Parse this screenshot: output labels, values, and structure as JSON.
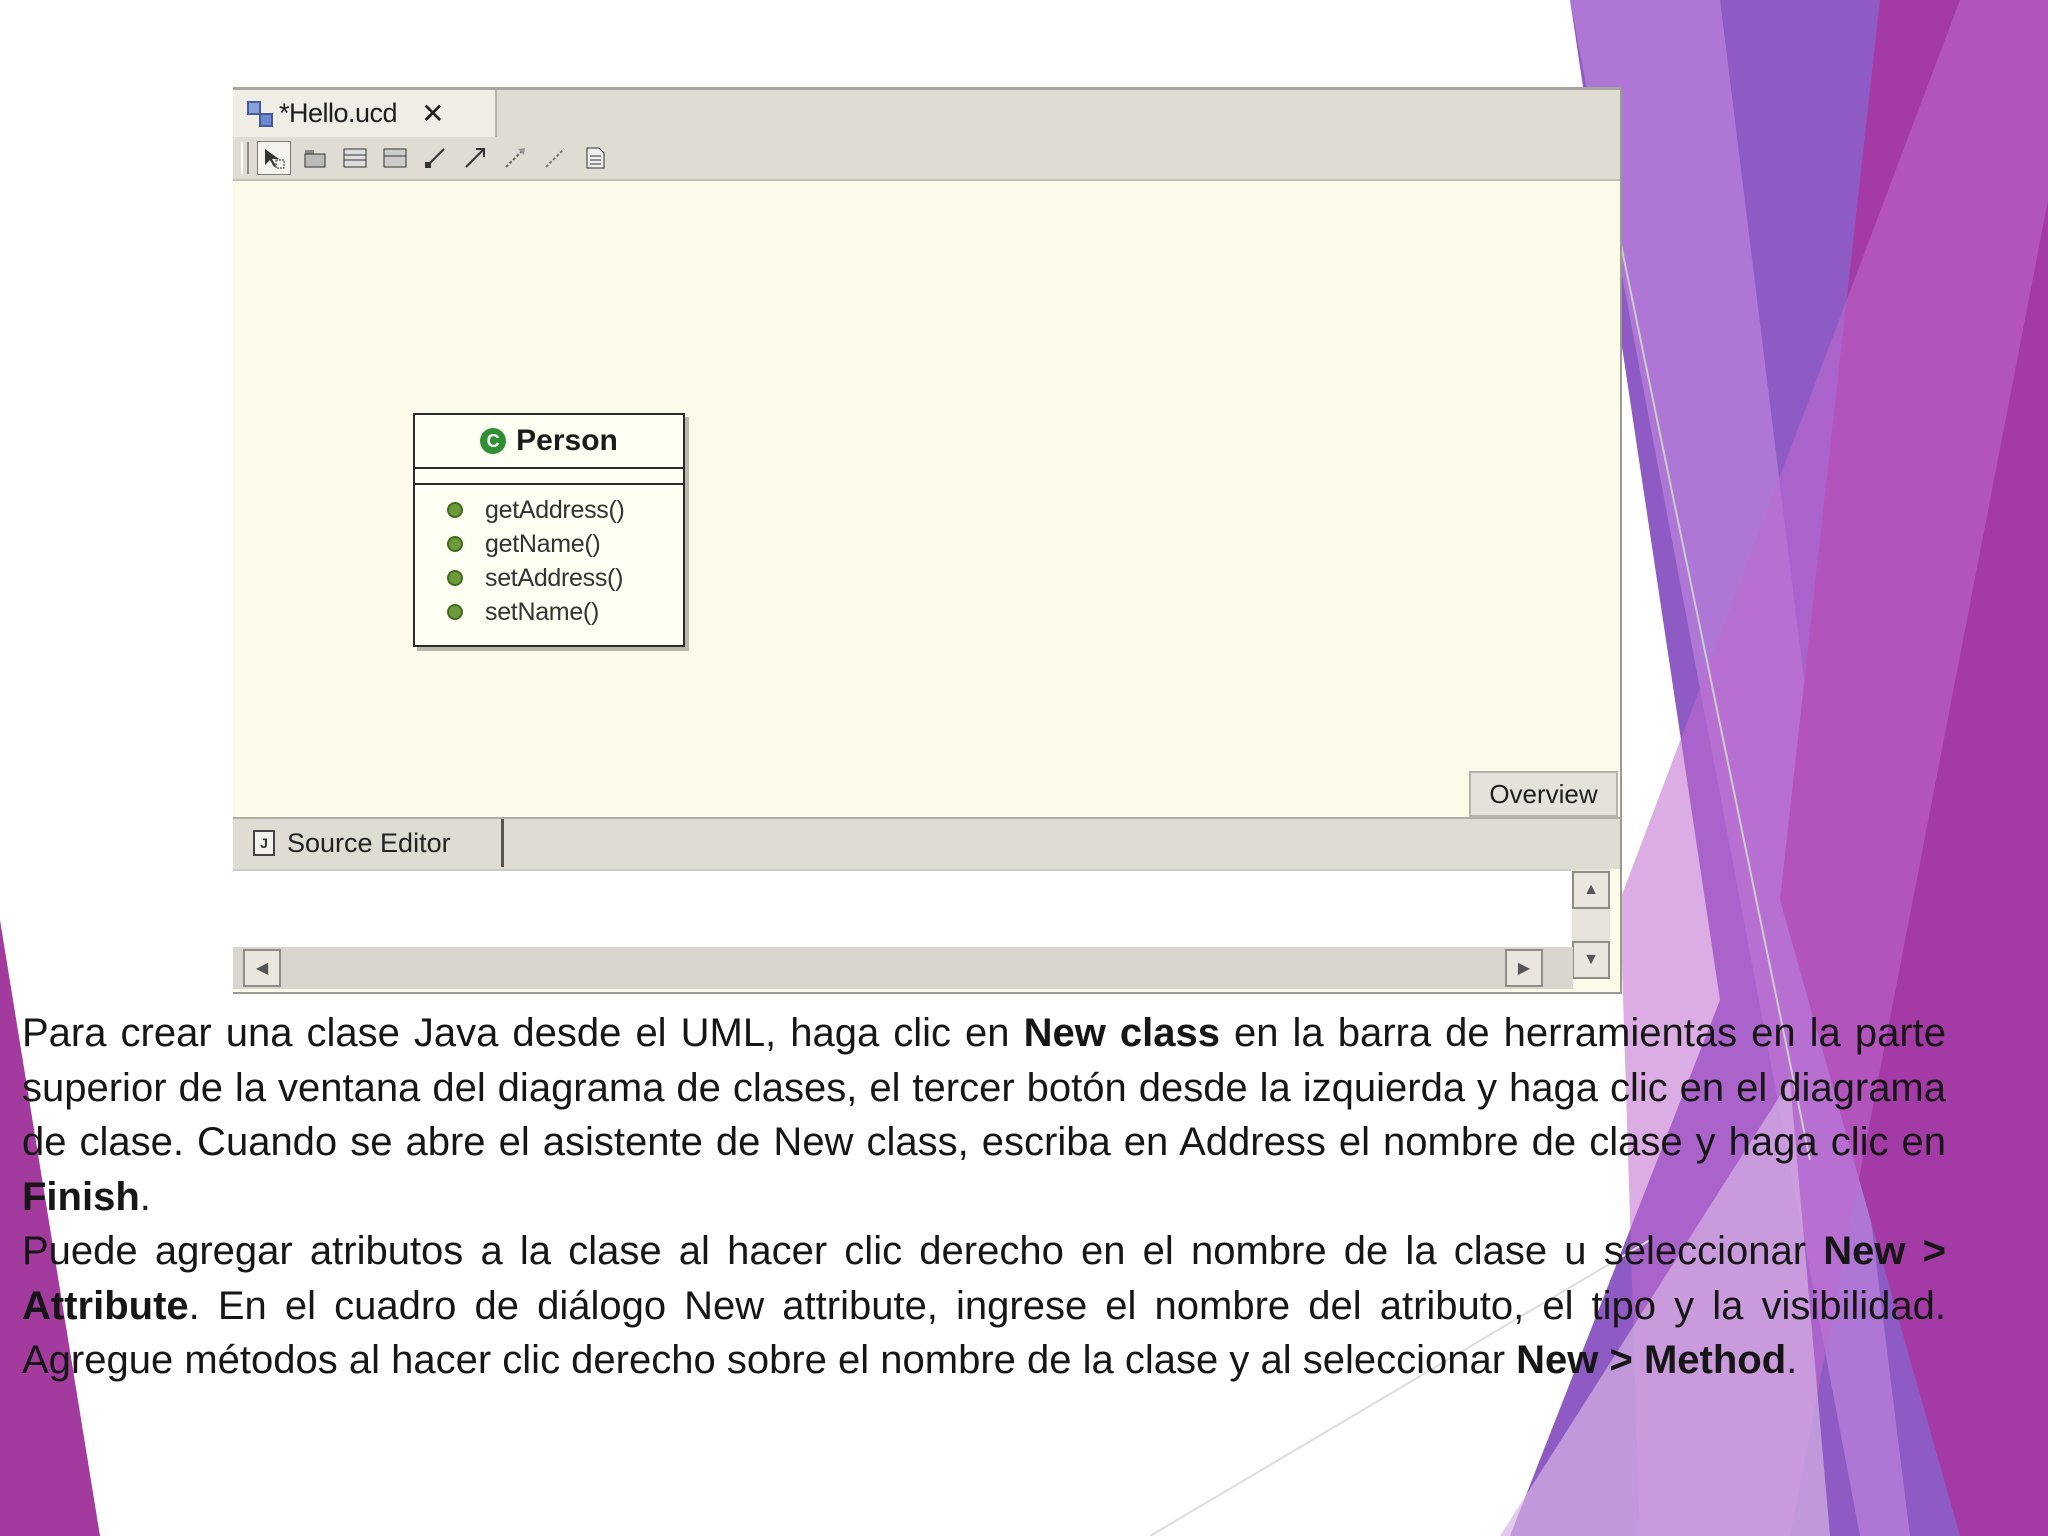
{
  "theme": {
    "accent_purple": "#9b59c6",
    "accent_magenta": "#b03aa6",
    "ide_canvas": "#fcfbea"
  },
  "editor": {
    "tab_title": "*Hello.ucd",
    "tab_close": "✕",
    "tab_icon": "uml-diagram-icon",
    "toolbar_icons": [
      "select-icon",
      "package-icon",
      "new-class-icon",
      "new-interface-icon",
      "dependency-icon",
      "association-icon",
      "generalization-icon",
      "realization-icon",
      "note-icon"
    ]
  },
  "diagram": {
    "class": {
      "icon_letter": "C",
      "name": "Person",
      "methods": [
        "getAddress()",
        "getName()",
        "setAddress()",
        "setName()"
      ]
    },
    "overview_label": "Overview"
  },
  "bottom_panel": {
    "source_editor_label": "Source Editor",
    "source_icon_letter": "J"
  },
  "text": {
    "p1_a": "Para crear una clase Java desde el UML, haga clic en ",
    "p1_b": "New class",
    "p1_c": " en la barra de herramientas en la parte superior de la ventana del diagrama de clases, el tercer botón desde la izquierda y haga clic en el diagrama de clase. Cuando se abre el asistente de New class, escriba en Address el nombre de clase y haga clic en ",
    "p1_d": "Finish",
    "p1_e": ".",
    "p2_a": "Puede agregar atributos a la clase al hacer clic derecho en el nombre de la clase u seleccionar ",
    "p2_b": "New > Attribute",
    "p2_c": ". En el cuadro de diálogo New attribute, ingrese el nombre del atributo, el tipo y la visibilidad. Agregue métodos al hacer clic derecho sobre el nombre de la clase y al seleccionar ",
    "p2_d": "New > Method",
    "p2_e": "."
  }
}
